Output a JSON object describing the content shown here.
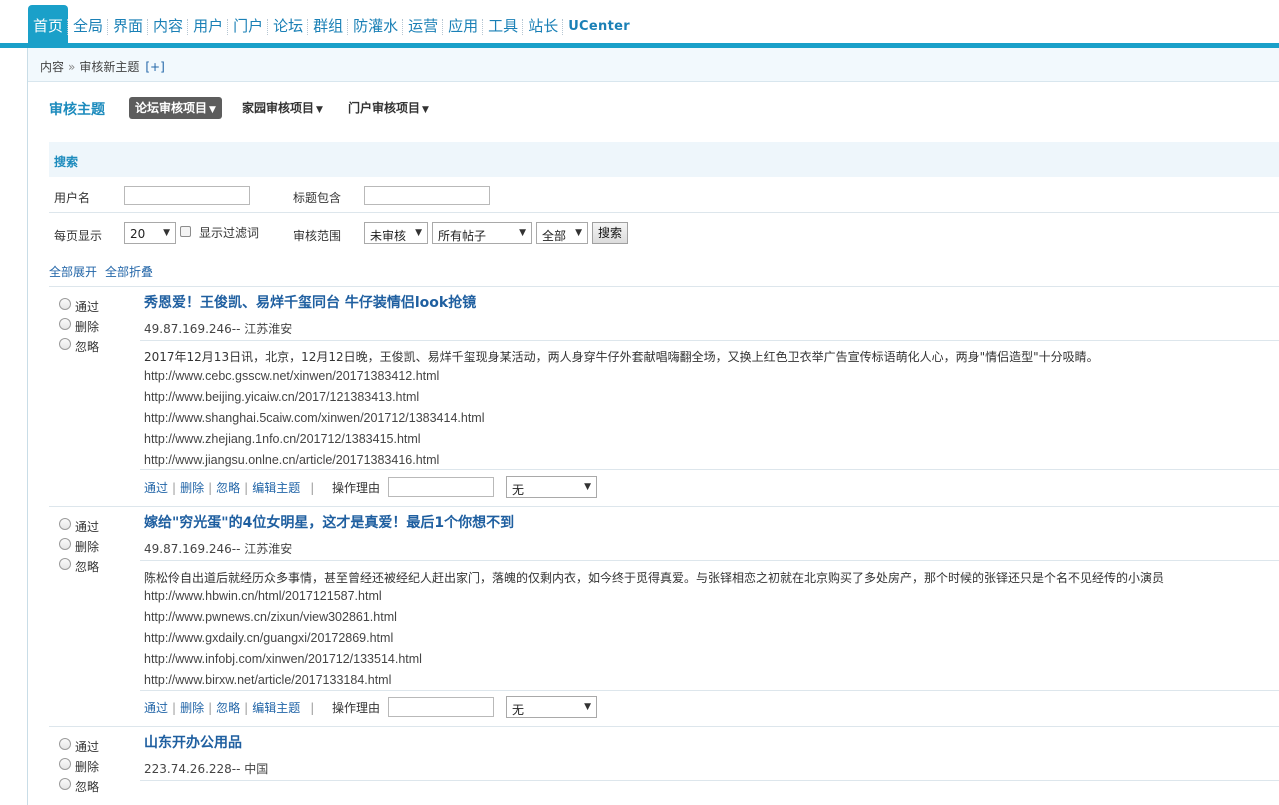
{
  "nav": {
    "items": [
      "首页",
      "全局",
      "界面",
      "内容",
      "用户",
      "门户",
      "论坛",
      "群组",
      "防灌水",
      "运营",
      "应用",
      "工具",
      "站长",
      "UCenter"
    ]
  },
  "breadcrumb": {
    "section": "内容",
    "sep": "»",
    "current": "审核新主题",
    "add": "[+]"
  },
  "page": {
    "title": "审核主题",
    "tabs": [
      "论坛审核项目",
      "家园审核项目",
      "门户审核项目"
    ],
    "tab_arrow": "▼"
  },
  "search": {
    "title": "搜索",
    "username_label": "用户名",
    "username_value": "",
    "subject_label": "标题包含",
    "subject_value": "",
    "perpage_label": "每页显示",
    "perpage_value": "20",
    "show_filter_label": "显示过滤词",
    "scope_label": "审核范围",
    "scope_value": "未审核",
    "posts_value": "所有帖子",
    "range_value": "全部",
    "search_button": "搜索"
  },
  "toggles": {
    "expand_all": "全部展开",
    "collapse_all": "全部折叠"
  },
  "labels": {
    "pass": "通过",
    "delete": "删除",
    "ignore": "忽略",
    "edit": "编辑主题",
    "reason": "操作理由",
    "reason_select": "无",
    "sep": "|"
  },
  "posts": [
    {
      "title": "秀恩爱！王俊凯、易烊千玺同台 牛仔装情侣look抢镜",
      "ip": "49.87.169.246-- 江苏淮安",
      "body": "2017年12月13日讯，北京，12月12日晚，王俊凯、易烊千玺现身某活动，两人身穿牛仔外套献唱嗨翻全场，又换上红色卫衣举广告宣传标语萌化人心，两身\"情侣造型\"十分吸睛。",
      "urls": [
        "http://www.cebc.gsscw.net/xinwen/20171383412.html",
        "http://www.beijing.yicaiw.cn/2017/121383413.html",
        "http://www.shanghai.5caiw.com/xinwen/201712/1383414.html",
        "http://www.zhejiang.1nfo.cn/201712/1383415.html",
        "http://www.jiangsu.onlne.cn/article/20171383416.html"
      ]
    },
    {
      "title": "嫁给\"穷光蛋\"的4位女明星，这才是真爱！最后1个你想不到",
      "ip": "49.87.169.246-- 江苏淮安",
      "body": "陈松伶自出道后就经历众多事情，甚至曾经还被经纪人赶出家门，落魄的仅剩内衣，如今终于觅得真爱。与张铎相恋之初就在北京购买了多处房产，那个时候的张铎还只是个名不见经传的小演员",
      "urls": [
        "http://www.hbwin.cn/html/2017121587.html",
        "http://www.pwnews.cn/zixun/view302861.html",
        "http://www.gxdaily.cn/guangxi/20172869.html",
        "http://www.infobj.com/xinwen/201712/133514.html",
        "http://www.birxw.net/article/2017133184.html"
      ]
    },
    {
      "title": "山东开办公用品",
      "ip": "223.74.26.228-- 中国",
      "body": "",
      "urls": []
    }
  ]
}
